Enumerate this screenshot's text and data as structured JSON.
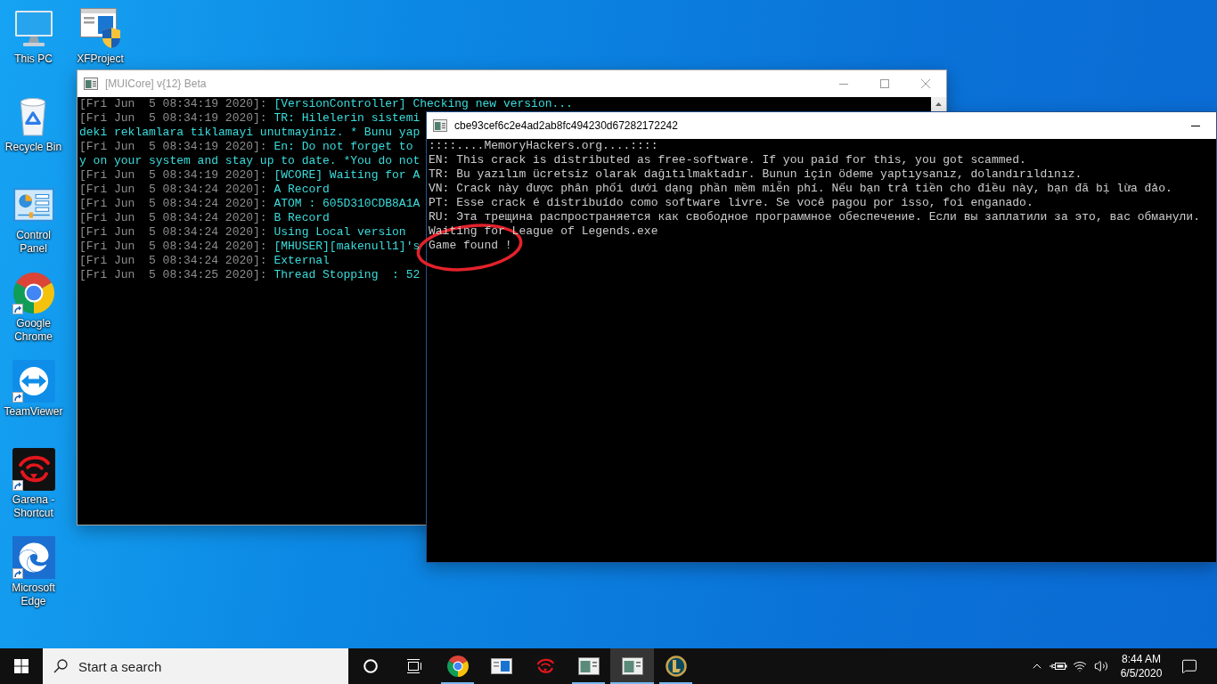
{
  "desktop": {
    "columns": [
      [
        {
          "label": "This PC",
          "shortcut": false
        },
        {
          "label": "Recycle Bin",
          "shortcut": false
        },
        {
          "label": "Control Panel",
          "shortcut": false
        },
        {
          "label": "Google Chrome",
          "shortcut": true
        },
        {
          "label": "TeamViewer",
          "shortcut": true
        },
        {
          "label": "Garena - Shortcut",
          "shortcut": true
        },
        {
          "label": "Microsoft Edge",
          "shortcut": true
        }
      ],
      [
        {
          "label": "XFProject",
          "shortcut": false
        }
      ]
    ]
  },
  "windows": [
    {
      "title": "[MUICore] v{12} Beta",
      "active": false,
      "log": [
        {
          "timestamp": "[Fri Jun  5 08:34:19 2020]:",
          "message": "[VersionController] Checking new version..."
        },
        {
          "timestamp": "[Fri Jun  5 08:34:19 2020]:",
          "message": "TR: Hilelerin sistemi",
          "continuation": "deki reklamlara tiklamayi unutmayiniz. * Bunu yap"
        },
        {
          "timestamp": "[Fri Jun  5 08:34:19 2020]:",
          "message": "En: Do not forget to",
          "continuation": "y on your system and stay up to date. *You do not"
        },
        {
          "timestamp": "[Fri Jun  5 08:34:19 2020]:",
          "message": "[WCORE] Waiting for A"
        },
        {
          "timestamp": "[Fri Jun  5 08:34:24 2020]:",
          "message": "A Record"
        },
        {
          "timestamp": "[Fri Jun  5 08:34:24 2020]:",
          "message": "ATOM : 605D310CDB8A1A"
        },
        {
          "timestamp": "[Fri Jun  5 08:34:24 2020]:",
          "message": "B Record"
        },
        {
          "timestamp": "[Fri Jun  5 08:34:24 2020]:",
          "message": "Using Local version"
        },
        {
          "timestamp": "[Fri Jun  5 08:34:24 2020]:",
          "message": "[MHUSER][makenull1]'s"
        },
        {
          "timestamp": "[Fri Jun  5 08:34:24 2020]:",
          "message": "External"
        },
        {
          "timestamp": "[Fri Jun  5 08:34:25 2020]:",
          "message": "Thread Stopping  : 52"
        }
      ]
    },
    {
      "title": "cbe93cef6c2e4ad2ab8fc494230d67282172242",
      "active": true,
      "lines": [
        "::::....MemoryHackers.org....::::",
        "EN: This crack is distributed as free-software. If you paid for this, you got scammed.",
        "TR: Bu yazılım ücretsiz olarak dağıtılmaktadır. Bunun için ödeme yaptıysanız, dolandırıldınız.",
        "VN: Crack này được phân phối dưới dạng phần mềm miễn phí. Nếu bạn trả tiền cho điều này, bạn đã bị lừa đảo.",
        "PT: Esse crack é distribuído como software livre. Se você pagou por isso, foi enganado.",
        "RU: Эта трещина распространяется как свободное программное обеспечение. Если вы заплатили за это, вас обманули.",
        "Waiting for League of Legends.exe",
        "Game found !"
      ]
    }
  ],
  "taskbar": {
    "search": {
      "placeholder": "Start a search"
    },
    "apps": [
      {
        "running": true,
        "active": false
      },
      {
        "running": false,
        "active": false
      },
      {
        "running": false,
        "active": false
      },
      {
        "running": true,
        "active": false
      },
      {
        "running": true,
        "active": true
      },
      {
        "running": true,
        "active": false
      }
    ],
    "clock": {
      "time": "8:44 AM",
      "date": "6/5/2020"
    }
  }
}
